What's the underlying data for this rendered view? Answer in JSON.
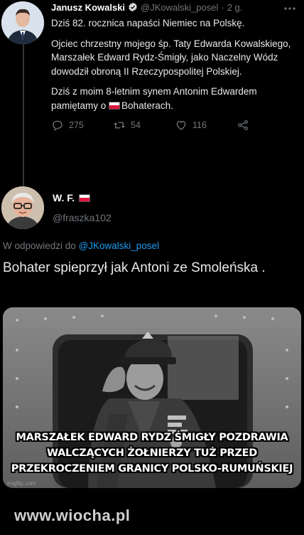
{
  "tweet1": {
    "author_name": "Janusz Kowalski",
    "handle": "@JKowalski_posel",
    "separator": "·",
    "time": "2 g.",
    "paragraphs": [
      "Dziś 82. rocznica napaści Niemiec na Polskę.",
      "Ojciec chrzestny mojego śp. Taty Edwarda Kowalskiego, Marszałek Edward Rydz-Śmigły, jako Naczelny Wódz dowodził obroną II Rzeczypospolitej Polskiej."
    ],
    "last_paragraph_start": "Dziś z moim 8-letnim synem Antonim Edwardem pamiętamy o ",
    "last_paragraph_end": "Bohaterach.",
    "replies": "275",
    "retweets": "54",
    "likes": "116"
  },
  "tweet2": {
    "author_name": "W. F.",
    "handle": "@fraszka102",
    "replying_prefix": "W odpowiedzi do",
    "replying_to": "@JKowalski_posel",
    "text": "Bohater spieprzył jak Antoni ze Smoleńska ."
  },
  "photo": {
    "caption_lines": [
      "MARSZAŁEK EDWARD RYDZ ŚMIGŁY POZDRAWIA",
      "WALCZĄCYCH ŻOŁNIERZY TUŻ PRZED",
      "PRZEKROCZENIEM GRANICY POLSKO-RUMUŃSKIEJ"
    ],
    "small_watermark": "imgflip.com"
  },
  "site_watermark": "www.wiocha.pl",
  "colors": {
    "background": "#000000",
    "link": "#1d9bf0",
    "muted": "#71767b",
    "flag_red": "#dc143c"
  },
  "icons": [
    "verified-badge-icon",
    "reply-icon",
    "retweet-icon",
    "like-icon",
    "share-icon",
    "more-icon",
    "polish-flag-icon"
  ]
}
